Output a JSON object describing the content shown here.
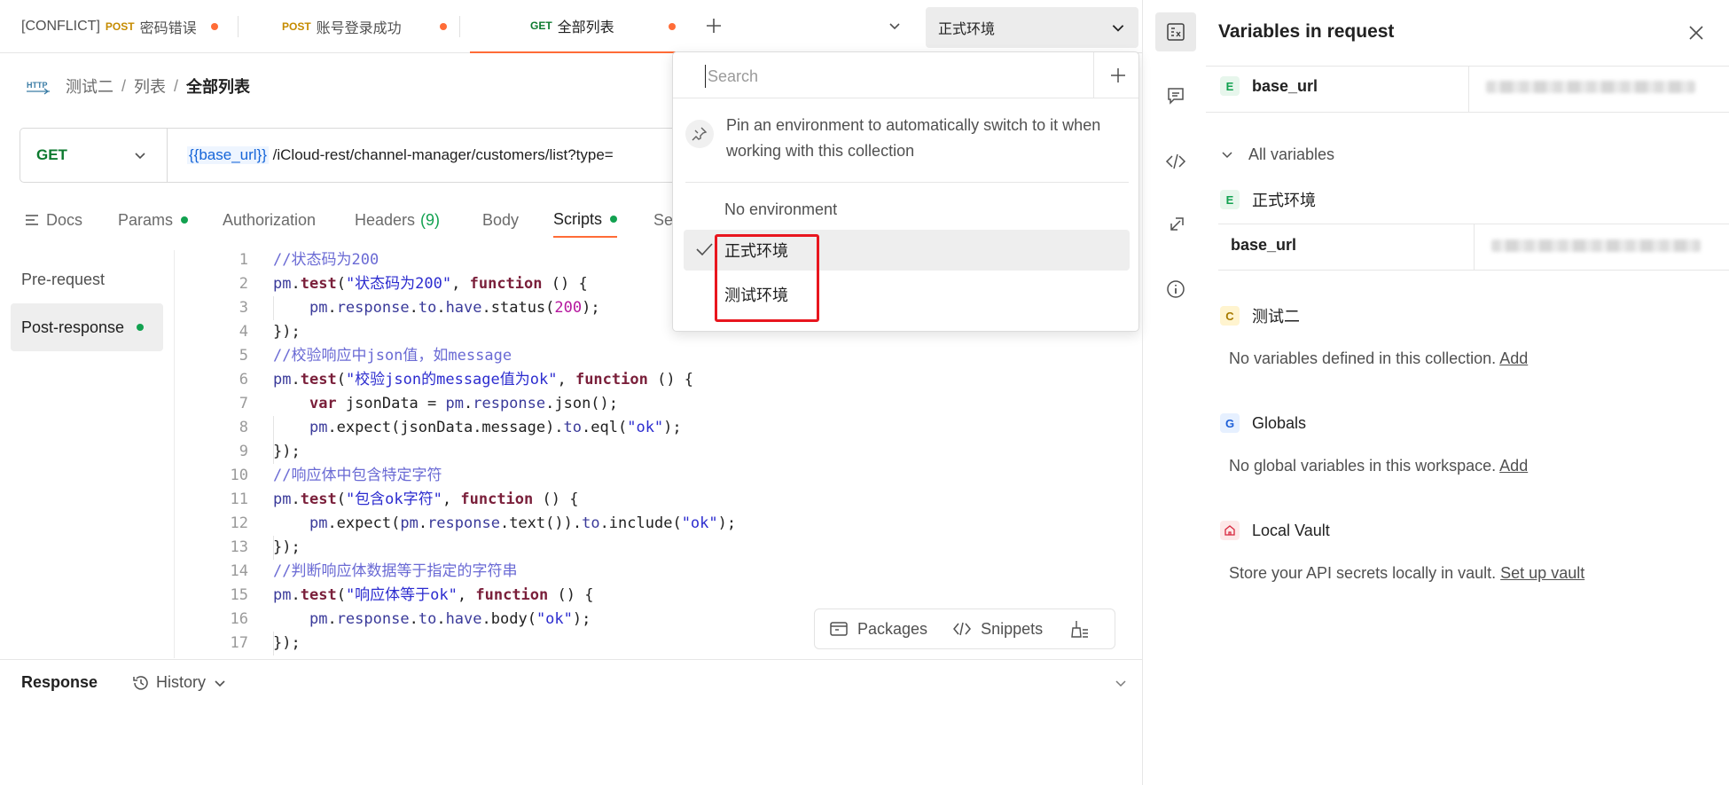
{
  "tabs": [
    {
      "prefix": "[CONFLICT]",
      "method": "POST",
      "title": "密码错误",
      "method_color": "#c58b00",
      "modified": true
    },
    {
      "prefix": "",
      "method": "POST",
      "title": "账号登录成功",
      "method_color": "#c58b00",
      "modified": true
    },
    {
      "prefix": "",
      "method": "GET",
      "title": "全部列表",
      "method_color": "#0d7a2f",
      "modified": true,
      "active": true
    }
  ],
  "environment_selector": {
    "selected": "正式环境"
  },
  "breadcrumb": {
    "collection": "测试二",
    "folder": "列表",
    "request": "全部列表",
    "separator": "/"
  },
  "request": {
    "method": "GET",
    "url_variable": "{{base_url}}",
    "url_path": " /iCloud-rest/channel-manager/customers/list?type="
  },
  "request_tabs": [
    {
      "label": "Docs",
      "icon": "docs-icon"
    },
    {
      "label": "Params",
      "dot": true
    },
    {
      "label": "Authorization"
    },
    {
      "label": "Headers",
      "count": "(9)"
    },
    {
      "label": "Body"
    },
    {
      "label": "Scripts",
      "dot": true,
      "active": true
    },
    {
      "label": "Se"
    }
  ],
  "script_nav": [
    {
      "label": "Pre-request"
    },
    {
      "label": "Post-response",
      "dot": true,
      "active": true
    }
  ],
  "code": [
    {
      "n": "1",
      "tokens": [
        [
          "c-comment",
          "//状态码为200"
        ]
      ]
    },
    {
      "n": "2",
      "tokens": [
        [
          "c-obj",
          "pm"
        ],
        [
          "c-plain",
          "."
        ],
        [
          "c-fn",
          "test"
        ],
        [
          "c-plain",
          "("
        ],
        [
          "c-str",
          "\"状态码为200\""
        ],
        [
          "c-plain",
          ", "
        ],
        [
          "c-kw",
          "function"
        ],
        [
          "c-plain",
          " () {"
        ]
      ]
    },
    {
      "n": "3",
      "tokens": [
        [
          "c-plain",
          "    "
        ],
        [
          "c-obj",
          "pm"
        ],
        [
          "c-plain",
          "."
        ],
        [
          "c-obj",
          "response"
        ],
        [
          "c-plain",
          "."
        ],
        [
          "c-obj",
          "to"
        ],
        [
          "c-plain",
          "."
        ],
        [
          "c-obj",
          "have"
        ],
        [
          "c-plain",
          ".status("
        ],
        [
          "c-num",
          "200"
        ],
        [
          "c-plain",
          ");"
        ]
      ]
    },
    {
      "n": "4",
      "tokens": [
        [
          "c-plain",
          "});"
        ]
      ]
    },
    {
      "n": "5",
      "tokens": [
        [
          "c-comment",
          "//校验响应中json值，如message"
        ]
      ]
    },
    {
      "n": "6",
      "tokens": [
        [
          "c-obj",
          "pm"
        ],
        [
          "c-plain",
          "."
        ],
        [
          "c-fn",
          "test"
        ],
        [
          "c-plain",
          "("
        ],
        [
          "c-str",
          "\"校验json的message值为ok\""
        ],
        [
          "c-plain",
          ", "
        ],
        [
          "c-kw",
          "function"
        ],
        [
          "c-plain",
          " () {"
        ]
      ]
    },
    {
      "n": "7",
      "tokens": [
        [
          "c-plain",
          "    "
        ],
        [
          "c-kw",
          "var"
        ],
        [
          "c-plain",
          " jsonData = "
        ],
        [
          "c-obj",
          "pm"
        ],
        [
          "c-plain",
          "."
        ],
        [
          "c-obj",
          "response"
        ],
        [
          "c-plain",
          ".json();"
        ]
      ]
    },
    {
      "n": "8",
      "tokens": [
        [
          "c-plain",
          "    "
        ],
        [
          "c-obj",
          "pm"
        ],
        [
          "c-plain",
          ".expect(jsonData.message)."
        ],
        [
          "c-obj",
          "to"
        ],
        [
          "c-plain",
          ".eql("
        ],
        [
          "c-str",
          "\"ok\""
        ],
        [
          "c-plain",
          ");"
        ]
      ]
    },
    {
      "n": "9",
      "tokens": [
        [
          "c-plain",
          "});"
        ]
      ]
    },
    {
      "n": "10",
      "tokens": [
        [
          "c-comment",
          "//响应体中包含特定字符"
        ]
      ]
    },
    {
      "n": "11",
      "tokens": [
        [
          "c-obj",
          "pm"
        ],
        [
          "c-plain",
          "."
        ],
        [
          "c-fn",
          "test"
        ],
        [
          "c-plain",
          "("
        ],
        [
          "c-str",
          "\"包含ok字符\""
        ],
        [
          "c-plain",
          ", "
        ],
        [
          "c-kw",
          "function"
        ],
        [
          "c-plain",
          " () {"
        ]
      ]
    },
    {
      "n": "12",
      "tokens": [
        [
          "c-plain",
          "    "
        ],
        [
          "c-obj",
          "pm"
        ],
        [
          "c-plain",
          ".expect("
        ],
        [
          "c-obj",
          "pm"
        ],
        [
          "c-plain",
          "."
        ],
        [
          "c-obj",
          "response"
        ],
        [
          "c-plain",
          ".text())."
        ],
        [
          "c-obj",
          "to"
        ],
        [
          "c-plain",
          ".include("
        ],
        [
          "c-str",
          "\"ok\""
        ],
        [
          "c-plain",
          ");"
        ]
      ]
    },
    {
      "n": "13",
      "tokens": [
        [
          "c-plain",
          "});"
        ]
      ]
    },
    {
      "n": "14",
      "tokens": [
        [
          "c-comment",
          "//判断响应体数据等于指定的字符串"
        ]
      ]
    },
    {
      "n": "15",
      "tokens": [
        [
          "c-obj",
          "pm"
        ],
        [
          "c-plain",
          "."
        ],
        [
          "c-fn",
          "test"
        ],
        [
          "c-plain",
          "("
        ],
        [
          "c-str",
          "\"响应体等于ok\""
        ],
        [
          "c-plain",
          ", "
        ],
        [
          "c-kw",
          "function"
        ],
        [
          "c-plain",
          " () {"
        ]
      ]
    },
    {
      "n": "16",
      "tokens": [
        [
          "c-plain",
          "    "
        ],
        [
          "c-obj",
          "pm"
        ],
        [
          "c-plain",
          "."
        ],
        [
          "c-obj",
          "response"
        ],
        [
          "c-plain",
          "."
        ],
        [
          "c-obj",
          "to"
        ],
        [
          "c-plain",
          "."
        ],
        [
          "c-obj",
          "have"
        ],
        [
          "c-plain",
          ".body("
        ],
        [
          "c-str",
          "\"ok\""
        ],
        [
          "c-plain",
          ");"
        ]
      ]
    },
    {
      "n": "17",
      "tokens": [
        [
          "c-plain",
          "});"
        ]
      ]
    }
  ],
  "editor_tools": {
    "packages": "Packages",
    "snippets": "Snippets"
  },
  "response_bar": {
    "response": "Response",
    "history": "History"
  },
  "env_dropdown": {
    "search_placeholder": "Search",
    "pin_text": "Pin an environment to automatically switch to it when working with this collection",
    "options": [
      {
        "label": "No environment"
      },
      {
        "label": "正式环境",
        "selected": true
      },
      {
        "label": "测试环境"
      }
    ]
  },
  "variables_panel": {
    "title": "Variables in request",
    "request_var": {
      "badge": "E",
      "name": "base_url"
    },
    "all_variables_label": "All variables",
    "environment": {
      "badge": "E",
      "name": "正式环境",
      "var_name": "base_url"
    },
    "collection": {
      "badge": "C",
      "name": "测试二",
      "note": "No variables defined in this collection.",
      "link": "Add"
    },
    "globals": {
      "badge": "G",
      "name": "Globals",
      "note": "No global variables in this workspace.",
      "link": "Add"
    },
    "vault": {
      "name": "Local Vault",
      "note": "Store your API secrets locally in vault.",
      "link": "Set up vault"
    }
  },
  "colors": {
    "accent": "#ff6c37",
    "success": "#12a150",
    "highlight": "#e8161e"
  }
}
